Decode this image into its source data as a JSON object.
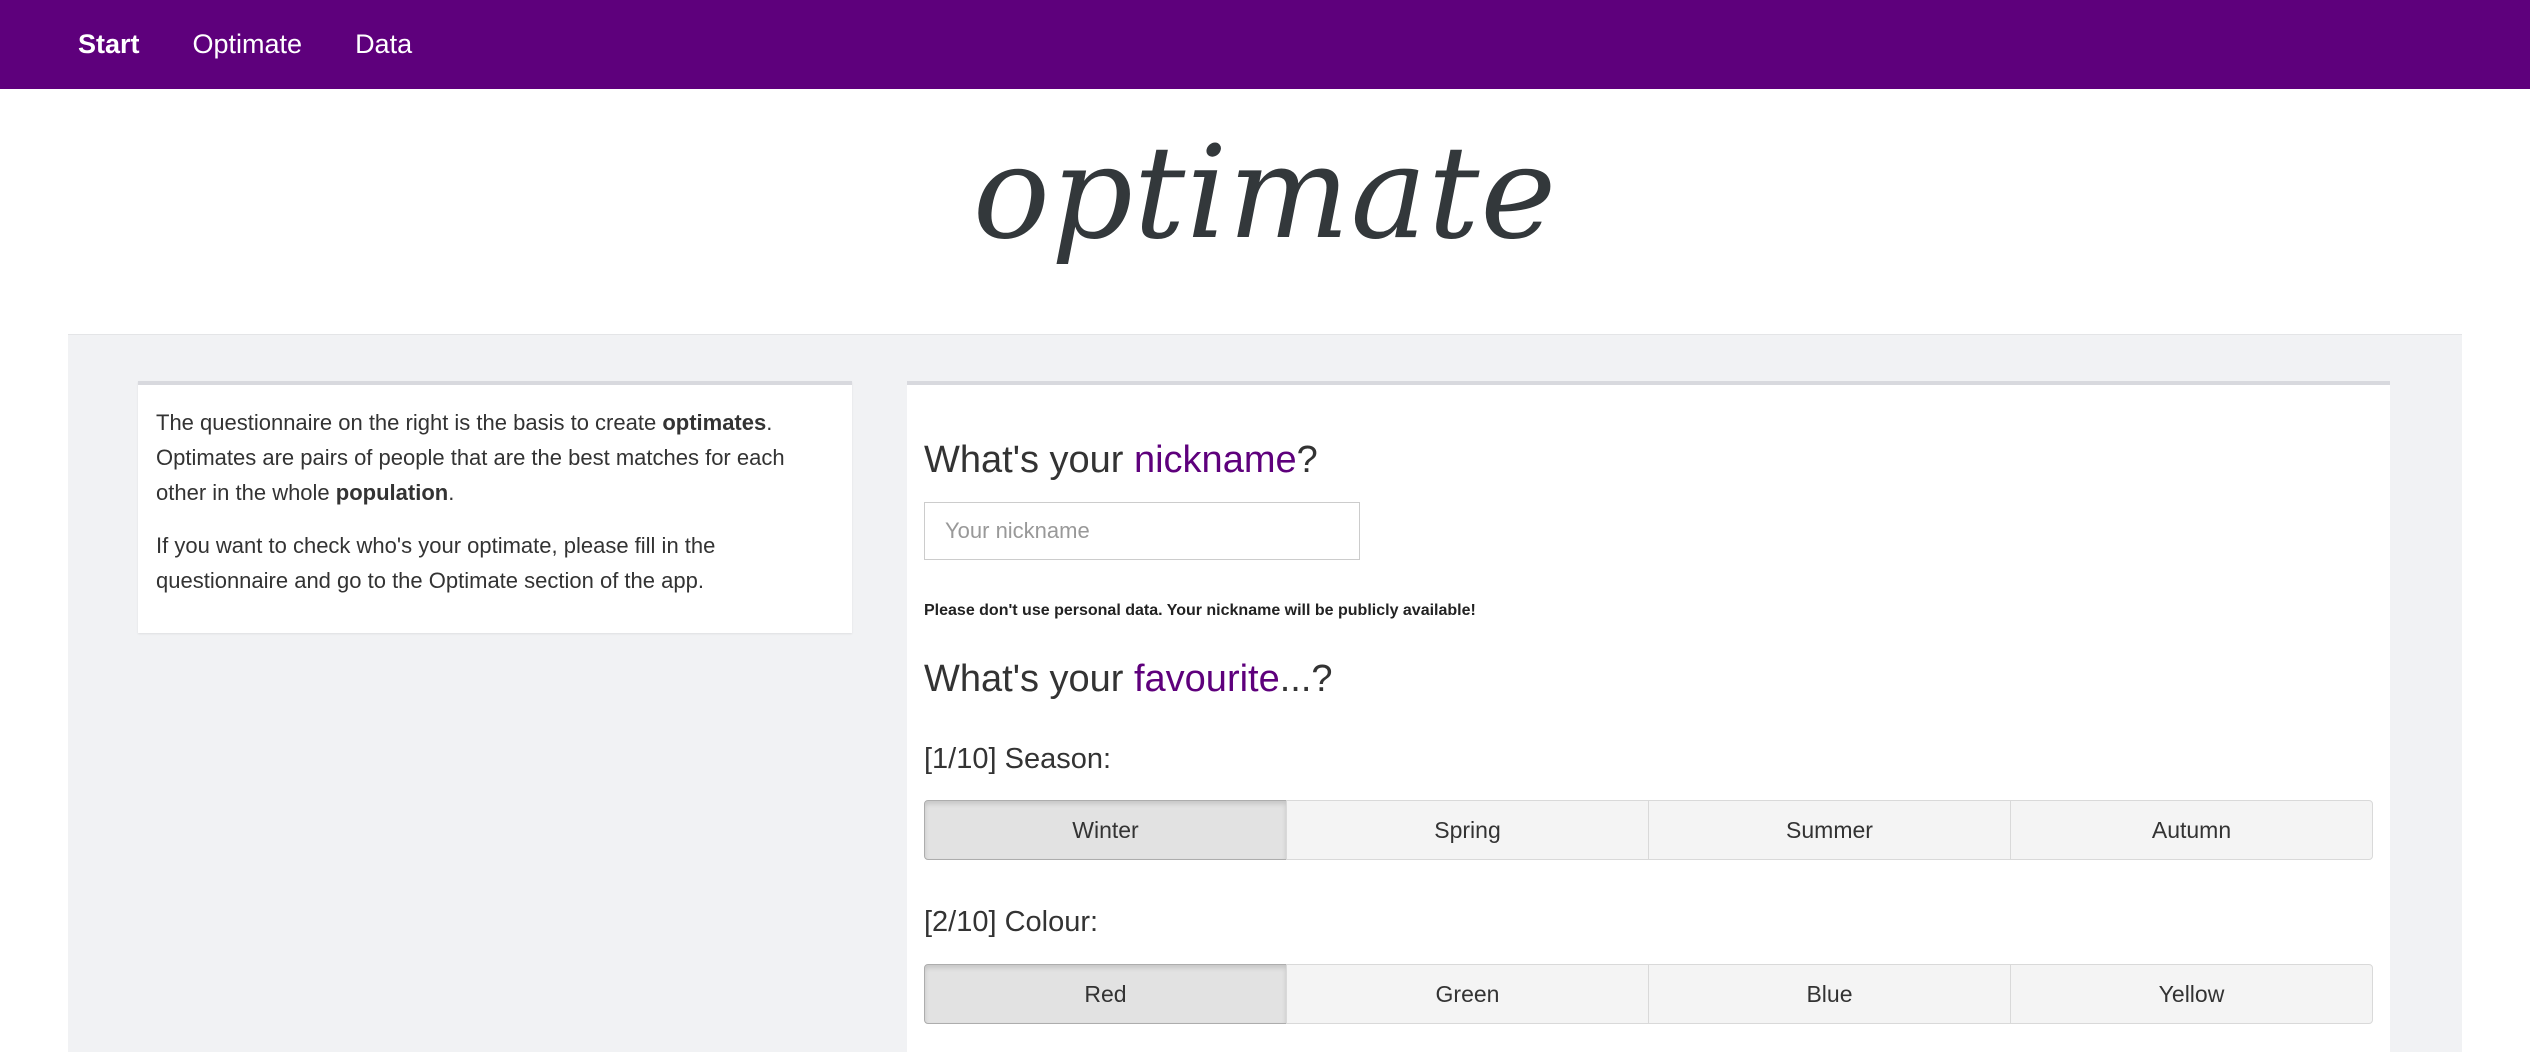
{
  "nav": {
    "items": [
      {
        "label": "Start",
        "active": true
      },
      {
        "label": "Optimate",
        "active": false
      },
      {
        "label": "Data",
        "active": false
      }
    ]
  },
  "logo": {
    "text": "optimate"
  },
  "intro": {
    "p1_a": "The questionnaire on the right is the basis to create ",
    "p1_b": "optimates",
    "p1_c": ". Optimates are pairs of people that are the best matches for each other in the whole ",
    "p1_d": "population",
    "p1_e": ".",
    "p2": "If you want to check who's your optimate, please fill in the questionnaire and go to the Optimate section of the app."
  },
  "nickname": {
    "heading_a": "What's your ",
    "heading_accent": "nickname",
    "heading_b": "?",
    "placeholder": "Your nickname",
    "value": "",
    "warning": "Please don't use personal data. Your nickname will be publicly available!"
  },
  "favourite": {
    "heading_a": "What's your ",
    "heading_accent": "favourite",
    "heading_b": "...?"
  },
  "questions": [
    {
      "label": "[1/10] Season:",
      "options": [
        "Winter",
        "Spring",
        "Summer",
        "Autumn"
      ],
      "selected": "Winter"
    },
    {
      "label": "[2/10] Colour:",
      "options": [
        "Red",
        "Green",
        "Blue",
        "Yellow"
      ],
      "selected": "Red"
    }
  ],
  "colors": {
    "brand": "#5e007c",
    "background": "#f1f2f4"
  }
}
